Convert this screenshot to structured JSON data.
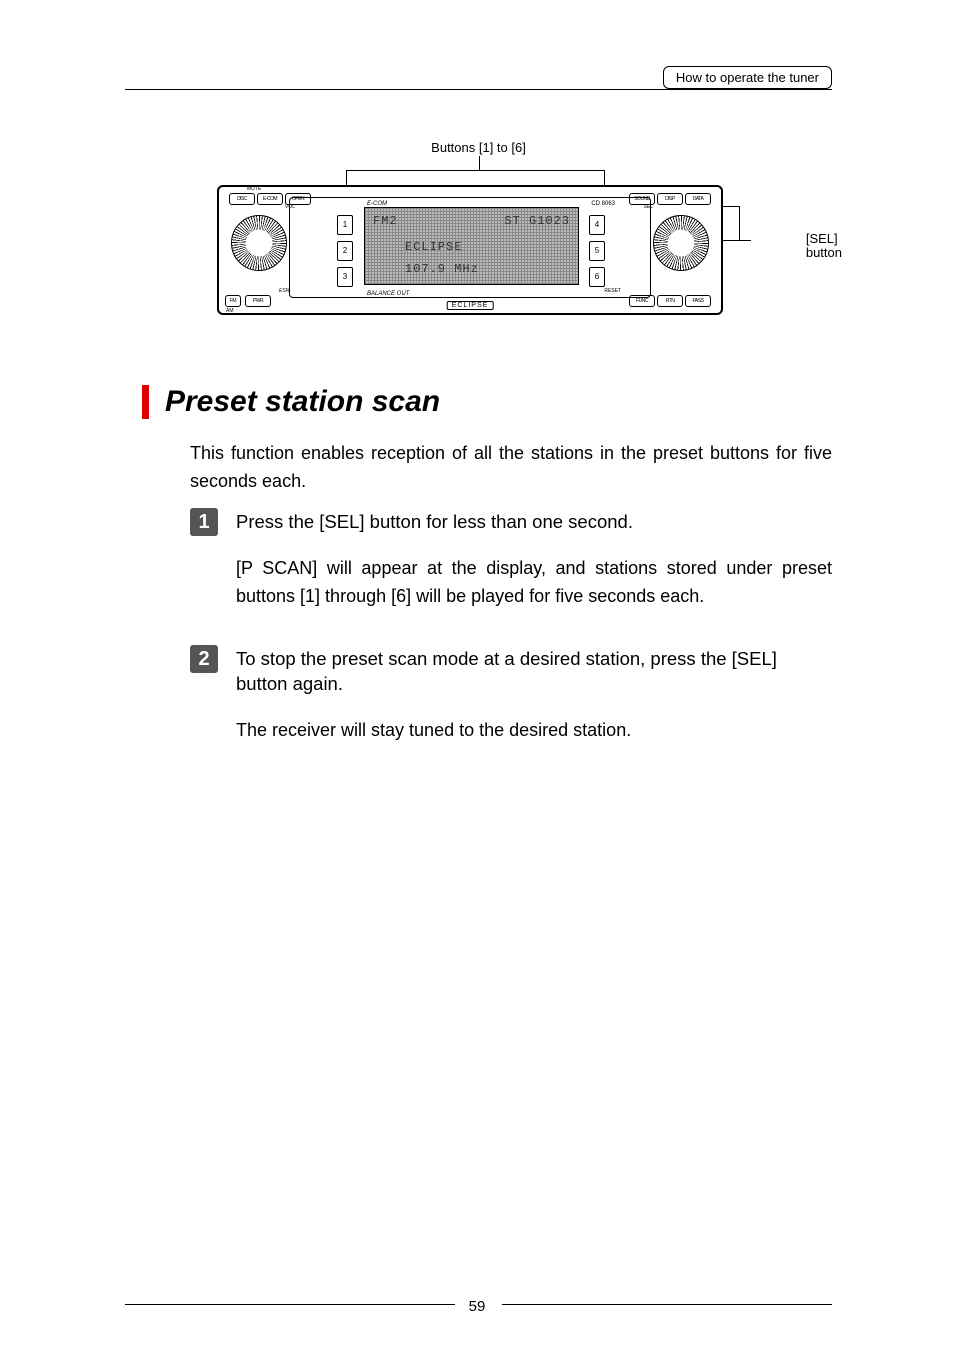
{
  "header": {
    "breadcrumb": "How to operate the tuner"
  },
  "diagram": {
    "top_callout": "Buttons [1] to [6]",
    "right_callout_line1": "[SEL]",
    "right_callout_line2": "button",
    "brand_label": "ECLIPSE",
    "cdm": "E-COM",
    "model": "CD 8063",
    "lcd": {
      "l1a": "FM2",
      "l1b": "ST  G1023",
      "l2": "ECLIPSE",
      "l3": "107.9  MHz"
    },
    "pill_disc": "DISC",
    "pill_open": "OPEN",
    "pill_mute": "MUTE",
    "pill_sound": "SOUND",
    "pill_disp": "DISP",
    "pill_data": "DATA",
    "pill_sel": "SEL",
    "pill_reset": "RESET",
    "pill_func": "FUNC",
    "pill_rtn": "RTN",
    "pill_pass": "PASS",
    "pill_fm": "FM",
    "pill_am": "AM",
    "pill_pwr": "PWR",
    "pill_esn": "ESN",
    "pill_vol": "VOL",
    "balance": "BALANCE OUT",
    "presets_left": [
      "1",
      "2",
      "3"
    ],
    "presets_right": [
      "4",
      "5",
      "6"
    ]
  },
  "heading": "Preset station scan",
  "intro": "This function enables reception of all the stations in the preset buttons for five seconds each.",
  "steps": [
    {
      "n": "1",
      "head": "Press the [SEL] button for less than one second.",
      "body": "[P SCAN] will appear at the display, and stations stored under preset buttons [1] through [6] will be played for five seconds each."
    },
    {
      "n": "2",
      "head": "To stop the preset scan mode at a desired station, press the [SEL] button again.",
      "body": "The receiver will stay tuned to the desired station."
    }
  ],
  "page_number": "59"
}
